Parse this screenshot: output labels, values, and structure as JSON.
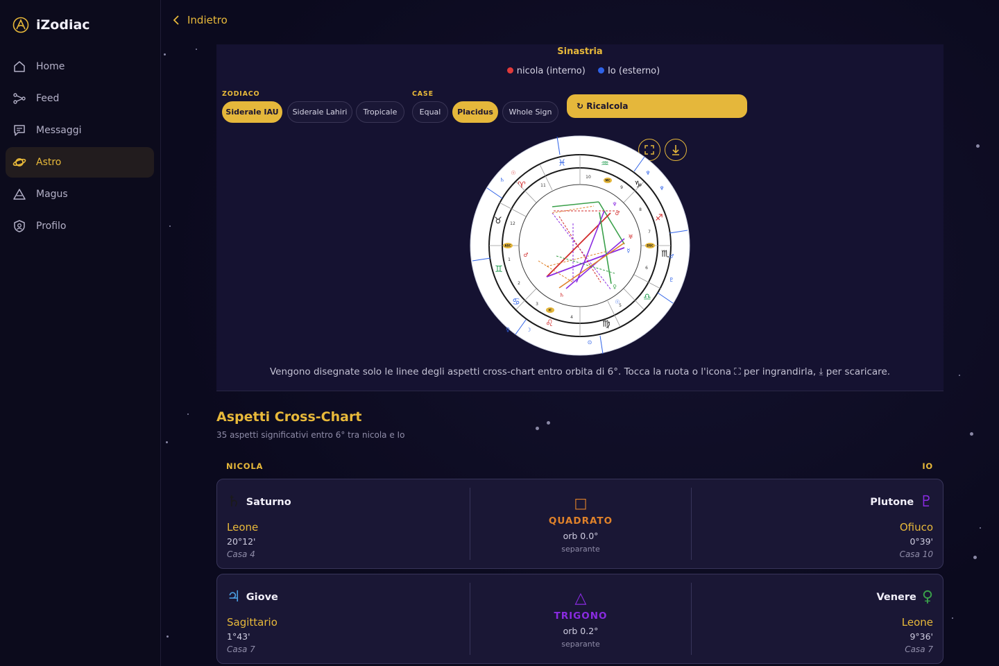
{
  "app": {
    "name": "iZodiac"
  },
  "nav": {
    "items": [
      {
        "label": "Home",
        "icon": "home-icon"
      },
      {
        "label": "Feed",
        "icon": "feed-icon"
      },
      {
        "label": "Messaggi",
        "icon": "messages-icon"
      },
      {
        "label": "Astro",
        "icon": "planet-icon",
        "active": true
      },
      {
        "label": "Magus",
        "icon": "pyramid-icon"
      },
      {
        "label": "Profilo",
        "icon": "profile-icon"
      }
    ]
  },
  "header": {
    "back_label": "Indietro"
  },
  "chart": {
    "title": "Sinastria",
    "legend": [
      {
        "label": "nicola (interno)",
        "color": "#e03a3a"
      },
      {
        "label": "Io (esterno)",
        "color": "#2e62e8"
      }
    ],
    "zodiac_label": "ZODIACO",
    "zodiac_options": [
      "Siderale IAU",
      "Siderale Lahiri",
      "Tropicale"
    ],
    "zodiac_selected": "Siderale IAU",
    "houses_label": "CASE",
    "house_options": [
      "Equal",
      "Placidus",
      "Whole Sign"
    ],
    "house_selected": "Placidus",
    "recalc_label": "↻ Ricalcola",
    "expand_icon": "expand-icon",
    "download_icon": "download-icon",
    "note": "Vengono disegnate solo le linee degli aspetti cross-chart entro orbita di 6°. Tocca la ruota o l'icona ⛶ per ingrandirla, ⤓ per scaricare."
  },
  "aspects": {
    "title": "Aspetti Cross-Chart",
    "subtitle": "35 aspetti significativi entro 6° tra nicola e Io",
    "left_header": "NICOLA",
    "right_header": "IO",
    "items": [
      {
        "left": {
          "planet": "Saturno",
          "glyph": "♄",
          "color": "#1a1a1a",
          "sign": "Leone",
          "degree": "20°12'",
          "house": "Casa 4"
        },
        "aspect": {
          "glyph": "□",
          "name": "QUADRATO",
          "orb": "orb 0.0°",
          "kind": "separante",
          "color": "#e0822a"
        },
        "right": {
          "planet": "Plutone",
          "glyph": "♇",
          "color": "#8a2be2",
          "sign": "Ofiuco",
          "degree": "0°39'",
          "house": "Casa 10"
        }
      },
      {
        "left": {
          "planet": "Giove",
          "glyph": "♃",
          "color": "#4a9de0",
          "sign": "Sagittario",
          "degree": "1°43'",
          "house": "Casa 7"
        },
        "aspect": {
          "glyph": "△",
          "name": "TRIGONO",
          "orb": "orb 0.2°",
          "kind": "separante",
          "color": "#8a2be2"
        },
        "right": {
          "planet": "Venere",
          "glyph": "♀",
          "color": "#3aa04a",
          "sign": "Leone",
          "degree": "9°36'",
          "house": "Casa 7"
        }
      }
    ]
  }
}
